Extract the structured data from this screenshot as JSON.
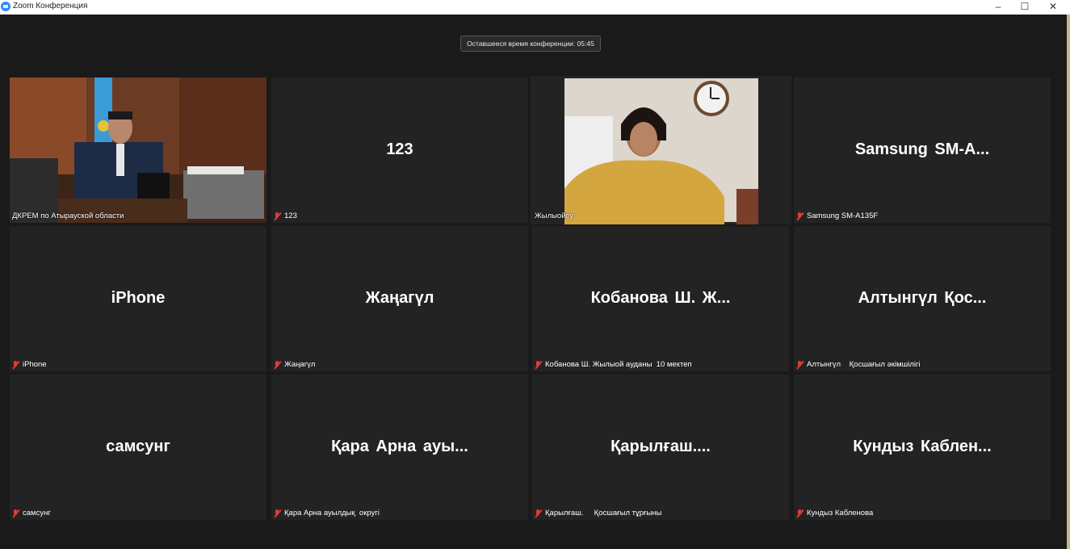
{
  "window": {
    "title": "Zoom Конференция",
    "minimize": "–",
    "maximize": "☐",
    "close": "✕"
  },
  "timer": {
    "text": "Оставшееся время конференции: 05:45"
  },
  "tiles": [
    {
      "name": "",
      "label": "ДКРЕМ по Атырауской области",
      "video": true,
      "muted": false
    },
    {
      "name": "123",
      "label": "123",
      "muted": true
    },
    {
      "name": "",
      "label": "Жылыойсу",
      "video": true,
      "muted": false,
      "active": true
    },
    {
      "name": "Samsung  SM-A...",
      "label": "Samsung SM-A135F",
      "muted": true
    },
    {
      "name": "iPhone",
      "label": "iPhone",
      "muted": true
    },
    {
      "name": "Жаңагүл",
      "label": "Жаңагүл",
      "muted": true
    },
    {
      "name": "Кобанова  Ш.  Ж...",
      "label": "Кобанова Ш. Жылыой ауданы  10 мектеп",
      "muted": true
    },
    {
      "name": "Алтынгүл    Қос...",
      "label": "Алтынгүл    Қосшағыл әкімшілігі",
      "muted": true
    },
    {
      "name": "самсунг",
      "label": "самсунг",
      "muted": true
    },
    {
      "name": "Қара  Арна  ауы...",
      "label": "Қара Арна ауылдық  округі",
      "muted": true
    },
    {
      "name": "Қарылғаш....",
      "label": "Қарылғаш.     Қосшағыл тұрғыны",
      "muted": true
    },
    {
      "name": "Кундыз  Каблен...",
      "label": "Кундыз Каблeнова",
      "muted": true
    }
  ],
  "colors": {
    "accent": "#b8d658",
    "mute": "#e03a3a",
    "tile": "#232323",
    "background": "#1a1a1a"
  }
}
